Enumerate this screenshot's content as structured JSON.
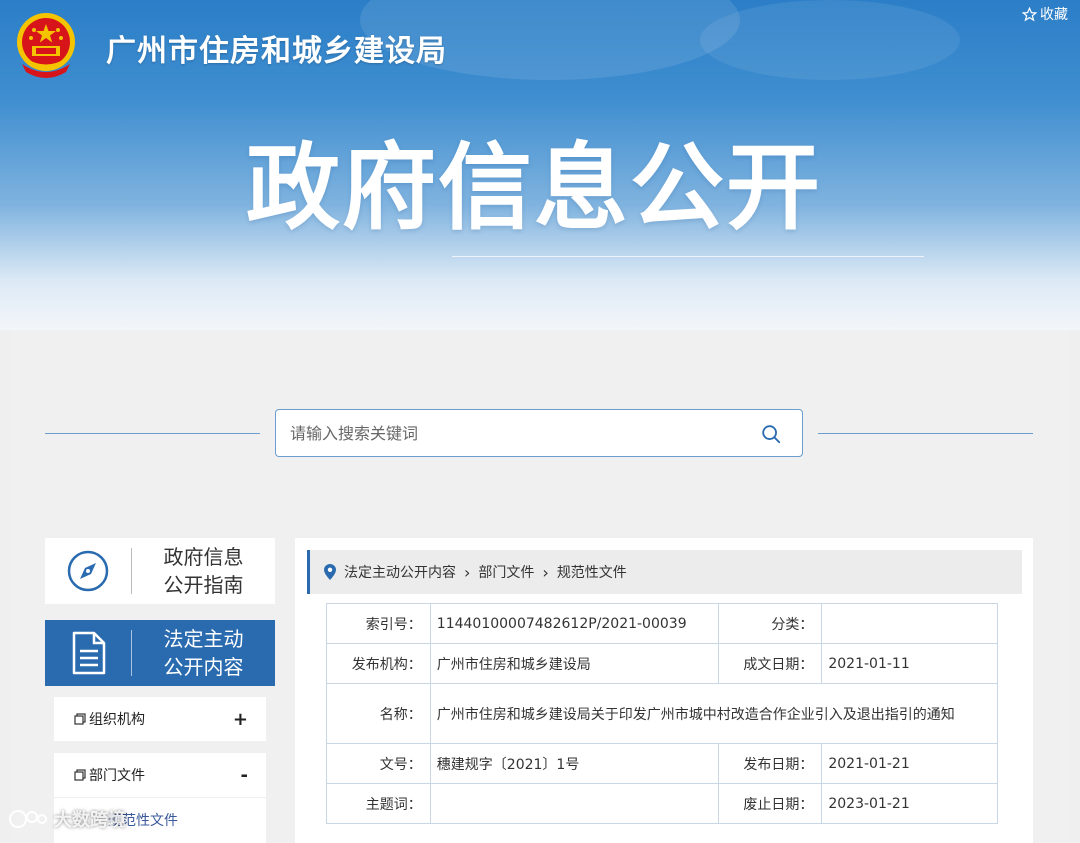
{
  "header": {
    "site_title": "广州市住房和城乡建设局",
    "collect_label": "收藏",
    "banner_title": "政府信息公开"
  },
  "search": {
    "placeholder": "请输入搜索关键词"
  },
  "sidebar": {
    "guide_line1": "政府信息",
    "guide_line2": "公开指南",
    "active_line1": "法定主动",
    "active_line2": "公开内容",
    "items": [
      {
        "label": "组织机构",
        "toggle": "+"
      },
      {
        "label": "部门文件",
        "toggle": "-"
      }
    ],
    "sub_items": [
      {
        "label": "规范性文件"
      }
    ]
  },
  "breadcrumb": [
    "法定主动公开内容",
    "部门文件",
    "规范性文件"
  ],
  "meta": {
    "index_label": "索引号：",
    "index_value": "11440100007482612P/2021-00039",
    "category_label": "分类：",
    "category_value": "",
    "publisher_label": "发布机构：",
    "publisher_value": "广州市住房和城乡建设局",
    "created_label": "成文日期：",
    "created_value": "2021-01-11",
    "name_label": "名称：",
    "name_value": "广州市住房和城乡建设局关于印发广州市城中村改造合作企业引入及退出指引的通知",
    "docno_label": "文号：",
    "docno_value": "穗建规字〔2021〕1号",
    "pubdate_label": "发布日期：",
    "pubdate_value": "2021-01-21",
    "subject_label": "主题词：",
    "subject_value": "",
    "expire_label": "废止日期：",
    "expire_value": "2023-01-21"
  },
  "watermark": "大数跨境",
  "colors": {
    "primary": "#2a6bb0",
    "emblem_red": "#d7141a",
    "emblem_gold": "#f5c400"
  }
}
